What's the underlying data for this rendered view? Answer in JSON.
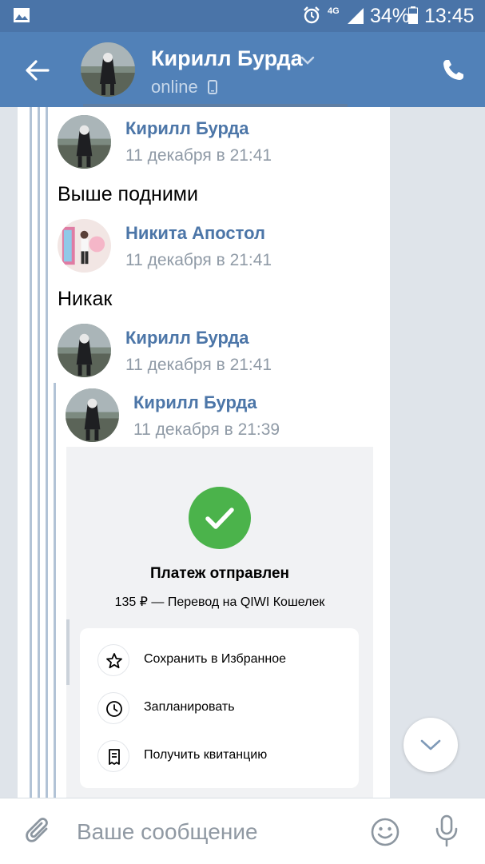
{
  "status_bar": {
    "network": "4G",
    "battery": "34%",
    "time": "13:45"
  },
  "header": {
    "name": "Кирилл Бурда",
    "status": "online"
  },
  "messages": [
    {
      "sender": "Кирилл Бурда",
      "time": "11 декабря в 21:41",
      "text": "Выше подними"
    },
    {
      "sender": "Никита Апостол",
      "time": "11 декабря в 21:41",
      "text": "Никак"
    },
    {
      "sender": "Кирилл Бурда",
      "time": "11 декабря в 21:41"
    },
    {
      "sender": "Кирилл Бурда",
      "time": "11 декабря в 21:39"
    }
  ],
  "payment_card": {
    "title": "Платеж отправлен",
    "subtitle": "135 ₽ — Перевод на QIWI Кошелек",
    "actions": [
      {
        "label": "Сохранить в Избранное",
        "icon": "star-icon"
      },
      {
        "label": "Запланировать",
        "icon": "clock-icon"
      },
      {
        "label": "Получить квитанцию",
        "icon": "receipt-icon"
      }
    ]
  },
  "composer": {
    "placeholder": "Ваше сообщение"
  },
  "colors": {
    "header": "#5181b8",
    "status_bar": "#4a74a8",
    "link": "#4c76a8",
    "success": "#4bb34b"
  }
}
